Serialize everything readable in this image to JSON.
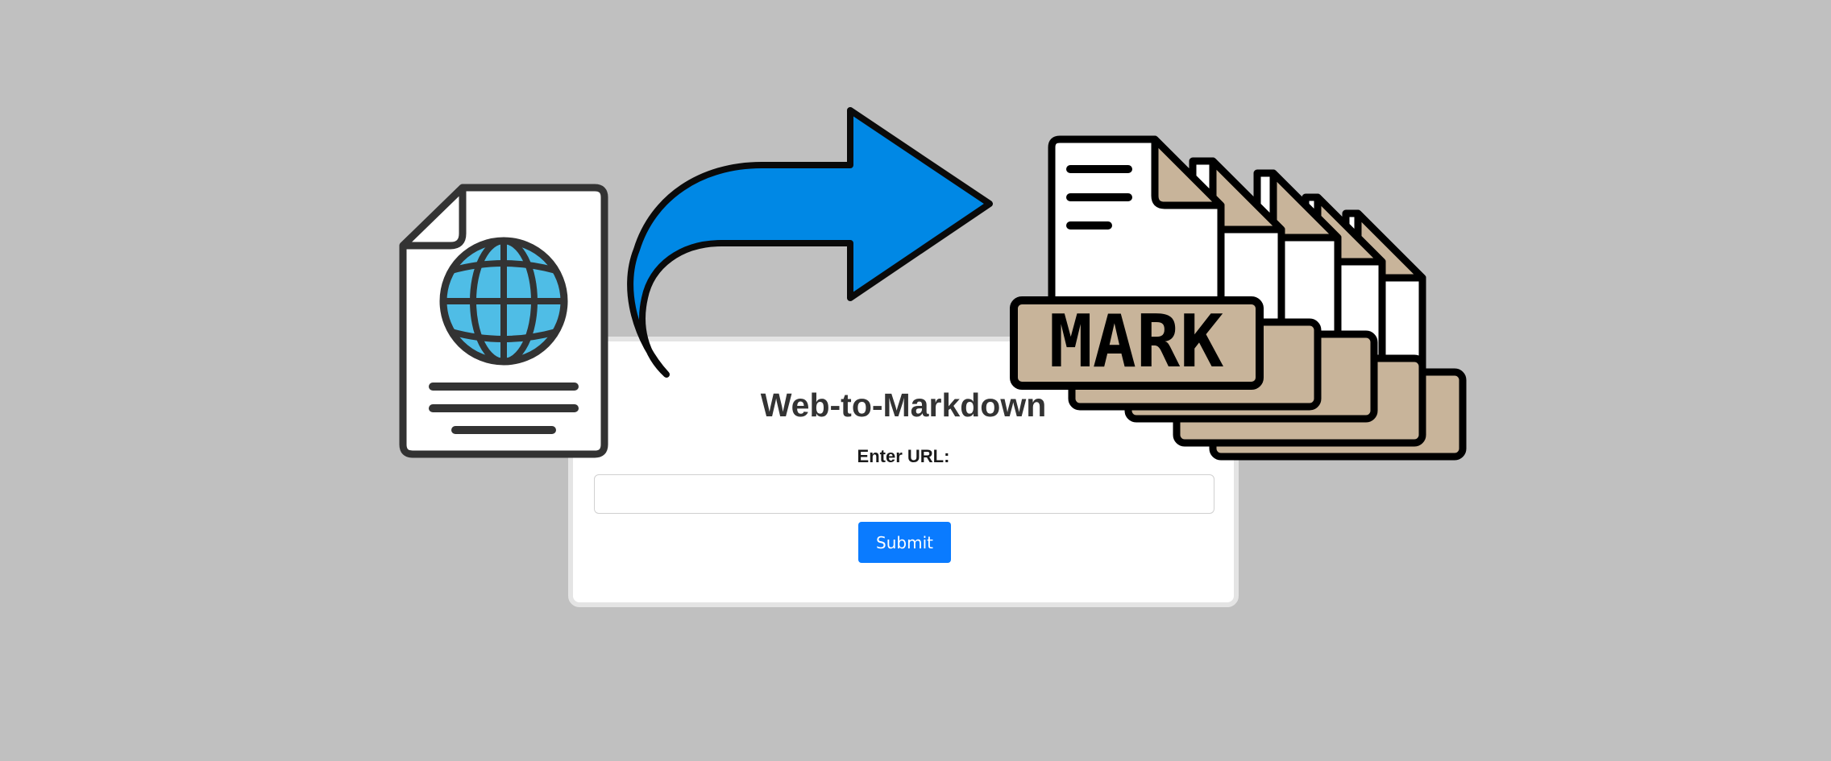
{
  "app": {
    "title": "Web-to-Markdown"
  },
  "form": {
    "url_label": "Enter URL:",
    "url_value": "",
    "url_placeholder": "",
    "submit_label": "Submit"
  },
  "banner": {
    "left_icon": "web-document-icon",
    "arrow_icon": "curved-arrow-right-icon",
    "right_icon": "markdown-files-stack-icon",
    "mark_text": "MARK"
  },
  "colors": {
    "background": "#c0c0c0",
    "card": "#ffffff",
    "submit_button": "#0a7bff",
    "arrow": "#0088e5",
    "globe": "#4fbde6",
    "mark_tag": "#c8b49a"
  }
}
